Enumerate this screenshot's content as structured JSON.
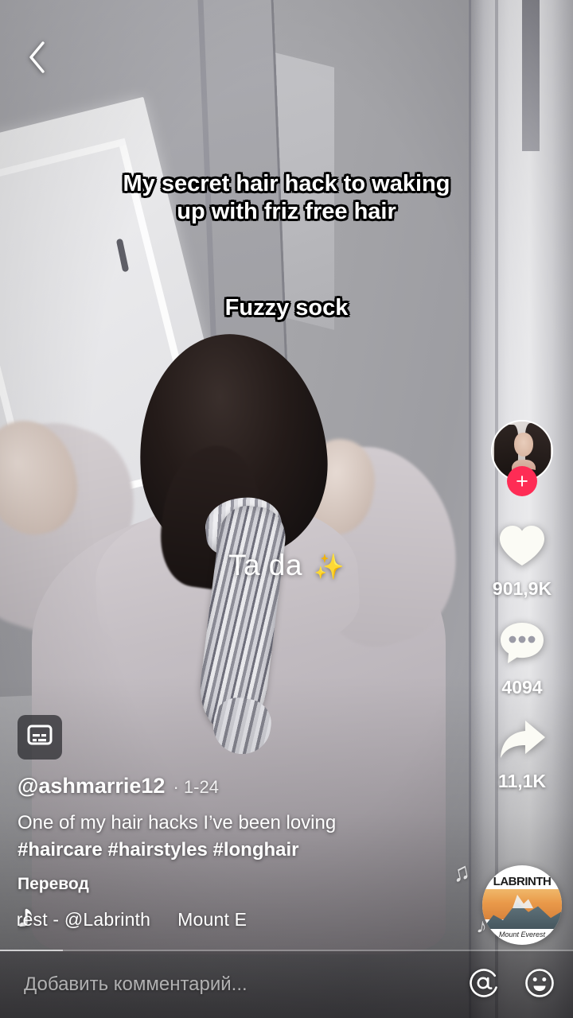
{
  "app": {
    "name": "TikTok",
    "accent_color": "#fe2c55"
  },
  "topbar": {
    "back_icon": "chevron-left-icon"
  },
  "video": {
    "overlay_text_line1": "My secret hair hack to waking up with friz free hair",
    "overlay_text_line2": "Fuzzy sock",
    "overlay_text_line3": "Ta da",
    "overlay_sparkle": "✨",
    "progress_percent": 11
  },
  "rail": {
    "avatar_label": "profile-avatar",
    "follow_label": "+",
    "items": [
      {
        "icon": "heart-icon",
        "name": "like-button",
        "count": "901,9K"
      },
      {
        "icon": "comment-icon",
        "name": "comment-button",
        "count": "4094"
      },
      {
        "icon": "share-icon",
        "name": "share-button",
        "count": "11,1K"
      }
    ],
    "music_disc": {
      "label_top": "LABRINTH",
      "label_bottom": "Mount Everest"
    }
  },
  "info": {
    "cc_icon": "subtitles-icon",
    "handle": "@ashmarrie12",
    "date": "· 1-24",
    "description": "One of my hair hacks I’ve been loving ",
    "hashtags": "#haircare #hairstyles #longhair",
    "translate_label": "Перевод",
    "music_note_icon": "music-note-icon",
    "music_title": "verest - @Labrinth",
    "music_title_tail": "Mount E"
  },
  "comment_bar": {
    "placeholder": "Добавить комментарий...",
    "mention_icon": "at-mention-icon",
    "emoji_icon": "emoji-smiley-icon"
  }
}
